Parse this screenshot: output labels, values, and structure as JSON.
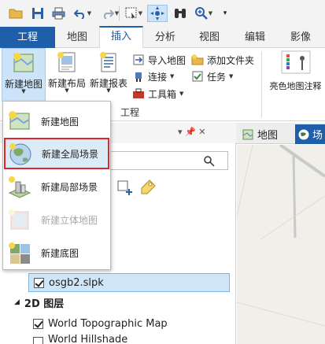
{
  "colors": {
    "accent": "#1f5ea8",
    "highlight_border": "#e0252b",
    "selected_bg": "#cfe6f8"
  },
  "qat": {
    "icons": [
      "folder-open-icon",
      "save-icon",
      "print-icon",
      "undo-icon",
      "redo-icon",
      "view-select-icon",
      "navigate-icon",
      "binoculars-icon",
      "zoom-icon",
      "customize-icon"
    ]
  },
  "tabs": [
    "工程",
    "地图",
    "插入",
    "分析",
    "视图",
    "编辑",
    "影像"
  ],
  "ribbon": {
    "new_map": "新建地图",
    "new_layout": "新建布局",
    "new_report": "新建报表",
    "import_map": "导入地图",
    "connect": "连接",
    "toolbox": "工具箱",
    "add_folder": "添加文件夹",
    "task": "任务",
    "group_project": "工程",
    "style_label": "亮色地图注释"
  },
  "menu": {
    "items": [
      {
        "label": "新建地图",
        "enabled": true
      },
      {
        "label": "新建全局场景",
        "enabled": true,
        "highlighted": true
      },
      {
        "label": "新建局部场景",
        "enabled": true
      },
      {
        "label": "新建立体地图",
        "enabled": false
      },
      {
        "label": "新建底图",
        "enabled": true
      }
    ]
  },
  "pane": {
    "pin": "▾ 📌 ✕",
    "layer_slpk": "osgb2.slpk",
    "group_2d": "2D 图层",
    "layer_topo": "World Topographic Map",
    "layer_hillshade": "World Hillshade"
  },
  "view": {
    "tab_map": "地图",
    "tab_scene": "场"
  }
}
